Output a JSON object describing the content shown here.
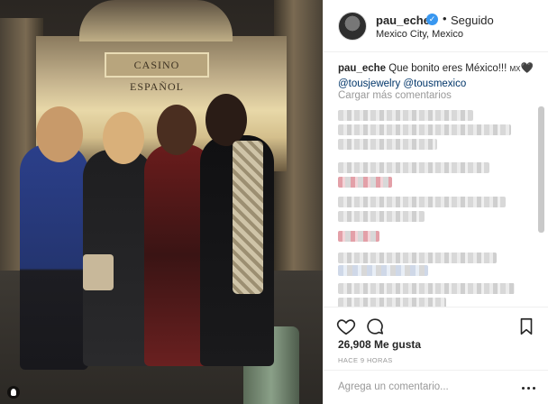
{
  "post": {
    "image_sign_text": "CASINO ESPAÑOL"
  },
  "header": {
    "username": "pau_eche",
    "separator": "•",
    "follow_status": "Seguido",
    "location": "Mexico City, Mexico",
    "verified_icon": "verified-badge-icon"
  },
  "caption": {
    "username": "pau_eche",
    "text": " Que bonito eres México!!! ",
    "flag": "MX",
    "heart": "🖤",
    "mention1": "@tousjewelry",
    "mention2": "@tousmexico"
  },
  "comments": {
    "load_more": "Cargar más comentarios"
  },
  "actions": {
    "like_icon": "heart-icon",
    "comment_icon": "comment-bubble-icon",
    "save_icon": "bookmark-icon",
    "likes": "26,908 Me gusta",
    "timestamp": "HACE 9 HORAS"
  },
  "add_comment": {
    "placeholder": "Agrega un comentario..."
  },
  "colors": {
    "link": "#003569",
    "muted": "#999999",
    "verified": "#3897f0",
    "text": "#262626"
  }
}
